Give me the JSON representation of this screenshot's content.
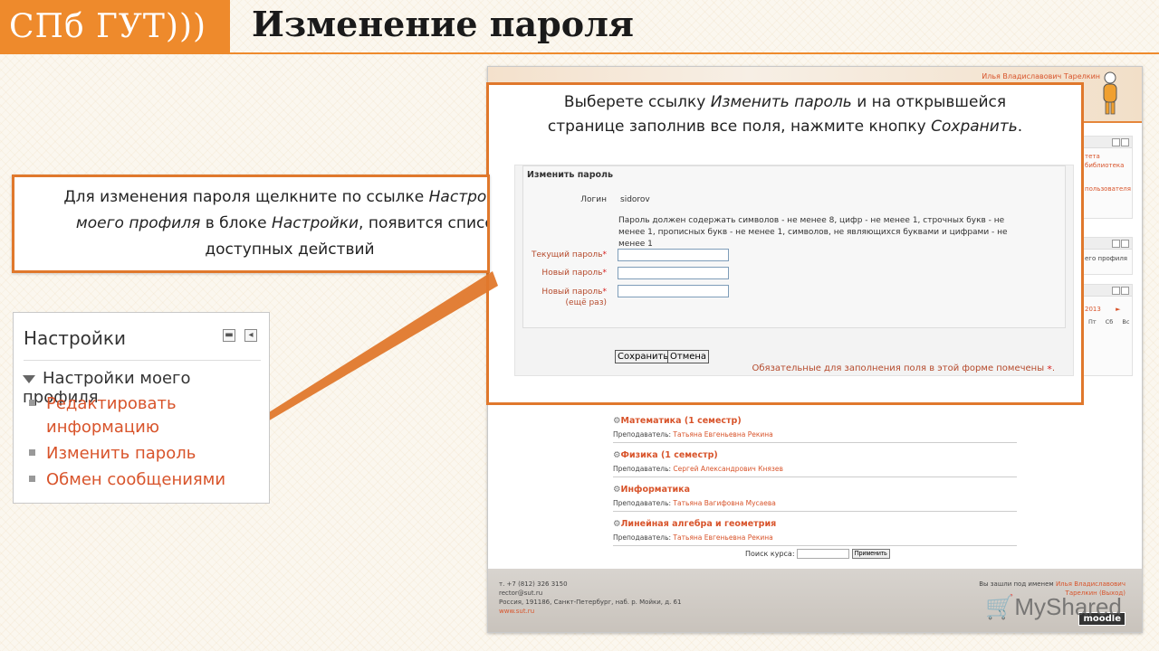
{
  "header": {
    "logo_text": "СПб ГУТ)))",
    "title": "Изменение пароля"
  },
  "moodle": {
    "user_link": "Илья Владиславович Тарелкин",
    "side_fragments": [
      "тета",
      "библиотека",
      "пользователя",
      "его профиля",
      "2013",
      "Пт",
      "Сб",
      "Вс"
    ],
    "courses": [
      {
        "title": "Математика (1 семестр)",
        "teacher_label": "Преподаватель:",
        "teacher": "Татьяна Евгеньевна Рекина"
      },
      {
        "title": "Физика (1 семестр)",
        "teacher_label": "Преподаватель:",
        "teacher": "Сергей Александрович Князев"
      },
      {
        "title": "Информатика",
        "teacher_label": "Преподаватель:",
        "teacher": "Татьяна Вагифовна Мусаева"
      },
      {
        "title": "Линейная алгебра и геометрия",
        "teacher_label": "Преподаватель:",
        "teacher": "Татьяна Евгеньевна Рекина"
      }
    ],
    "search": {
      "label": "Поиск курса:",
      "button": "Применить",
      "value": ""
    },
    "footer": {
      "phone": "т. +7 (812) 326 3150",
      "email": "rector@sut.ru",
      "address": "Россия, 191186, Санкт-Петербург, наб. р. Мойки, д. 61",
      "site": "www.sut.ru",
      "logged_as": "Вы зашли под именем",
      "user": "Илья Владиславович",
      "user2": "Тарелкин",
      "logout": "(Выход)",
      "moodle_logo": "moodle"
    }
  },
  "callout_right": {
    "line1_a": "Выберете ссылку ",
    "line1_i": "Изменить пароль",
    "line1_b": " и на открывшейся",
    "line2_a": "странице заполнив все поля, нажмите кнопку ",
    "line2_i": "Сохранить",
    "line2_b": "."
  },
  "form": {
    "legend": "Изменить пароль",
    "login_label": "Логин",
    "login_value": "sidorov",
    "rules": "Пароль должен содержать символов - не менее 8, цифр - не менее 1, строчных букв - не менее 1, прописных букв - не менее 1, символов, не являющихся буквами и цифрами - не менее 1",
    "current_label": "Текущий пароль",
    "new_label": "Новый пароль",
    "repeat_label_1": "Новый пароль",
    "repeat_label_2": "(ещё раз)",
    "current_value": "",
    "new_value": "",
    "repeat_value": "",
    "required_mark": "*",
    "save_button": "Сохранить",
    "cancel_button": "Отмена",
    "required_note": "Обязательные для заполнения поля в этой форме помечены"
  },
  "callout_left": {
    "line1_a": "Для изменения пароля щелкните по ссылке ",
    "line1_i": "Настройки",
    "line2_i": "моего профиля",
    "line2_a": " в блоке ",
    "line2_i2": "Настройки",
    "line2_b": ", появится список",
    "line3": "доступных действий"
  },
  "settings_block": {
    "title": "Настройки",
    "profile": "Настройки моего профиля",
    "items": [
      "Редактировать информацию",
      "Изменить пароль",
      "Обмен сообщениями"
    ]
  },
  "watermark": "MyShared"
}
